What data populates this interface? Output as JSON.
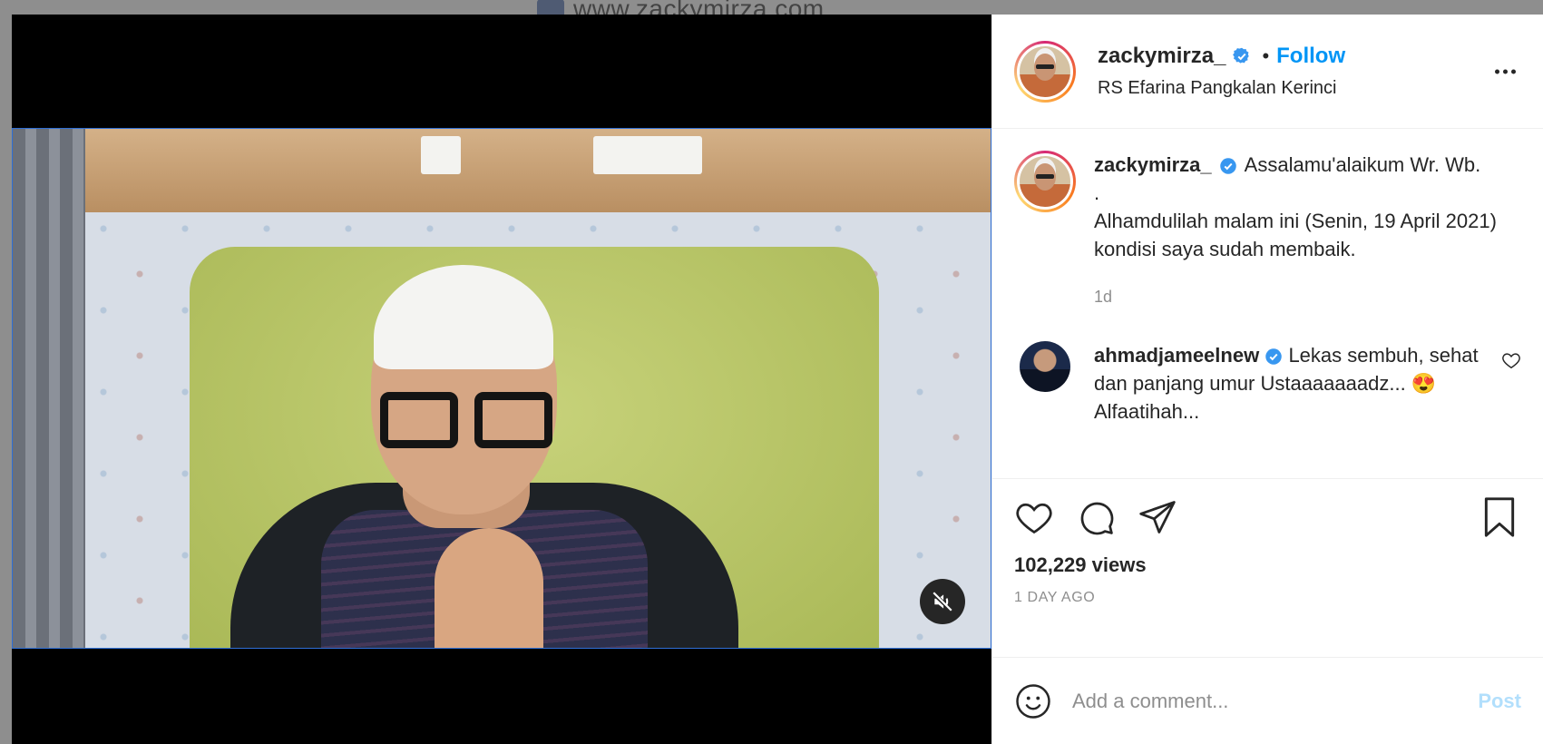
{
  "background": {
    "url_text": "www.zackymirza.com"
  },
  "post": {
    "author": {
      "username": "zackymirza_",
      "verified": true,
      "avatar_icon": "profile-photo"
    },
    "follow_label": "Follow",
    "separator": "•",
    "location": "RS Efarina Pangkalan Kerinci",
    "more_icon": "ellipsis-icon",
    "caption": {
      "username": "zackymirza_",
      "line1": "Assalamu'alaikum Wr. Wb.",
      "line2": ".",
      "line3": "Alhamdulilah malam ini (Senin, 19 April 2021) kondisi saya sudah membaik.",
      "time": "1d"
    },
    "comments": [
      {
        "username": "ahmadjameelnew",
        "verified": true,
        "text": "Lekas sembuh, sehat dan panjang umur Ustaaaaaaadz... 😍 Alfaatihah..."
      }
    ],
    "views": "102,229 views",
    "date": "1 DAY AGO",
    "add_comment_placeholder": "Add a comment...",
    "post_label": "Post",
    "video": {
      "muted": true,
      "mute_icon": "muted-speaker-icon"
    }
  },
  "colors": {
    "accent": "#0095f6",
    "post_disabled": "#b2dffc",
    "verified": "#3897f0"
  }
}
